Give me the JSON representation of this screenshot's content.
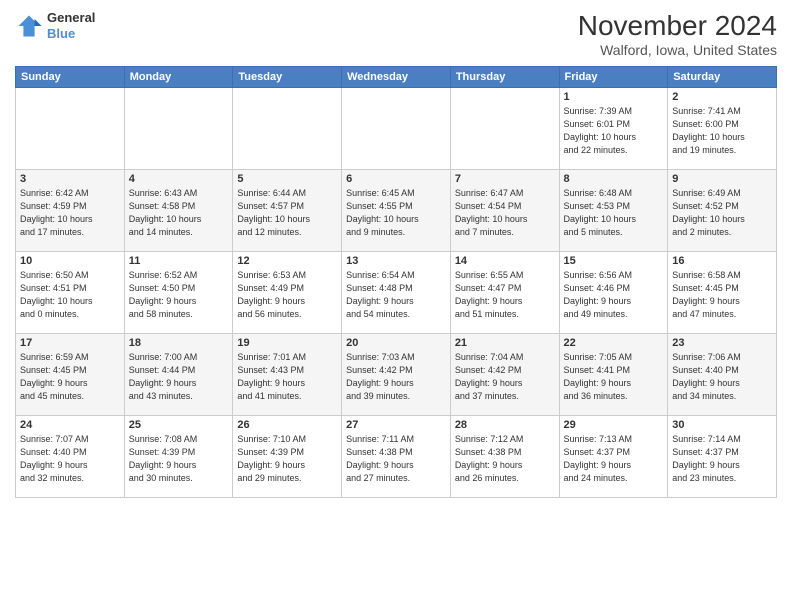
{
  "header": {
    "logo": {
      "line1": "General",
      "line2": "Blue"
    },
    "month": "November 2024",
    "location": "Walford, Iowa, United States"
  },
  "days_of_week": [
    "Sunday",
    "Monday",
    "Tuesday",
    "Wednesday",
    "Thursday",
    "Friday",
    "Saturday"
  ],
  "weeks": [
    [
      {
        "day": "",
        "info": ""
      },
      {
        "day": "",
        "info": ""
      },
      {
        "day": "",
        "info": ""
      },
      {
        "day": "",
        "info": ""
      },
      {
        "day": "",
        "info": ""
      },
      {
        "day": "1",
        "info": "Sunrise: 7:39 AM\nSunset: 6:01 PM\nDaylight: 10 hours\nand 22 minutes."
      },
      {
        "day": "2",
        "info": "Sunrise: 7:41 AM\nSunset: 6:00 PM\nDaylight: 10 hours\nand 19 minutes."
      }
    ],
    [
      {
        "day": "3",
        "info": "Sunrise: 6:42 AM\nSunset: 4:59 PM\nDaylight: 10 hours\nand 17 minutes."
      },
      {
        "day": "4",
        "info": "Sunrise: 6:43 AM\nSunset: 4:58 PM\nDaylight: 10 hours\nand 14 minutes."
      },
      {
        "day": "5",
        "info": "Sunrise: 6:44 AM\nSunset: 4:57 PM\nDaylight: 10 hours\nand 12 minutes."
      },
      {
        "day": "6",
        "info": "Sunrise: 6:45 AM\nSunset: 4:55 PM\nDaylight: 10 hours\nand 9 minutes."
      },
      {
        "day": "7",
        "info": "Sunrise: 6:47 AM\nSunset: 4:54 PM\nDaylight: 10 hours\nand 7 minutes."
      },
      {
        "day": "8",
        "info": "Sunrise: 6:48 AM\nSunset: 4:53 PM\nDaylight: 10 hours\nand 5 minutes."
      },
      {
        "day": "9",
        "info": "Sunrise: 6:49 AM\nSunset: 4:52 PM\nDaylight: 10 hours\nand 2 minutes."
      }
    ],
    [
      {
        "day": "10",
        "info": "Sunrise: 6:50 AM\nSunset: 4:51 PM\nDaylight: 10 hours\nand 0 minutes."
      },
      {
        "day": "11",
        "info": "Sunrise: 6:52 AM\nSunset: 4:50 PM\nDaylight: 9 hours\nand 58 minutes."
      },
      {
        "day": "12",
        "info": "Sunrise: 6:53 AM\nSunset: 4:49 PM\nDaylight: 9 hours\nand 56 minutes."
      },
      {
        "day": "13",
        "info": "Sunrise: 6:54 AM\nSunset: 4:48 PM\nDaylight: 9 hours\nand 54 minutes."
      },
      {
        "day": "14",
        "info": "Sunrise: 6:55 AM\nSunset: 4:47 PM\nDaylight: 9 hours\nand 51 minutes."
      },
      {
        "day": "15",
        "info": "Sunrise: 6:56 AM\nSunset: 4:46 PM\nDaylight: 9 hours\nand 49 minutes."
      },
      {
        "day": "16",
        "info": "Sunrise: 6:58 AM\nSunset: 4:45 PM\nDaylight: 9 hours\nand 47 minutes."
      }
    ],
    [
      {
        "day": "17",
        "info": "Sunrise: 6:59 AM\nSunset: 4:45 PM\nDaylight: 9 hours\nand 45 minutes."
      },
      {
        "day": "18",
        "info": "Sunrise: 7:00 AM\nSunset: 4:44 PM\nDaylight: 9 hours\nand 43 minutes."
      },
      {
        "day": "19",
        "info": "Sunrise: 7:01 AM\nSunset: 4:43 PM\nDaylight: 9 hours\nand 41 minutes."
      },
      {
        "day": "20",
        "info": "Sunrise: 7:03 AM\nSunset: 4:42 PM\nDaylight: 9 hours\nand 39 minutes."
      },
      {
        "day": "21",
        "info": "Sunrise: 7:04 AM\nSunset: 4:42 PM\nDaylight: 9 hours\nand 37 minutes."
      },
      {
        "day": "22",
        "info": "Sunrise: 7:05 AM\nSunset: 4:41 PM\nDaylight: 9 hours\nand 36 minutes."
      },
      {
        "day": "23",
        "info": "Sunrise: 7:06 AM\nSunset: 4:40 PM\nDaylight: 9 hours\nand 34 minutes."
      }
    ],
    [
      {
        "day": "24",
        "info": "Sunrise: 7:07 AM\nSunset: 4:40 PM\nDaylight: 9 hours\nand 32 minutes."
      },
      {
        "day": "25",
        "info": "Sunrise: 7:08 AM\nSunset: 4:39 PM\nDaylight: 9 hours\nand 30 minutes."
      },
      {
        "day": "26",
        "info": "Sunrise: 7:10 AM\nSunset: 4:39 PM\nDaylight: 9 hours\nand 29 minutes."
      },
      {
        "day": "27",
        "info": "Sunrise: 7:11 AM\nSunset: 4:38 PM\nDaylight: 9 hours\nand 27 minutes."
      },
      {
        "day": "28",
        "info": "Sunrise: 7:12 AM\nSunset: 4:38 PM\nDaylight: 9 hours\nand 26 minutes."
      },
      {
        "day": "29",
        "info": "Sunrise: 7:13 AM\nSunset: 4:37 PM\nDaylight: 9 hours\nand 24 minutes."
      },
      {
        "day": "30",
        "info": "Sunrise: 7:14 AM\nSunset: 4:37 PM\nDaylight: 9 hours\nand 23 minutes."
      }
    ]
  ]
}
